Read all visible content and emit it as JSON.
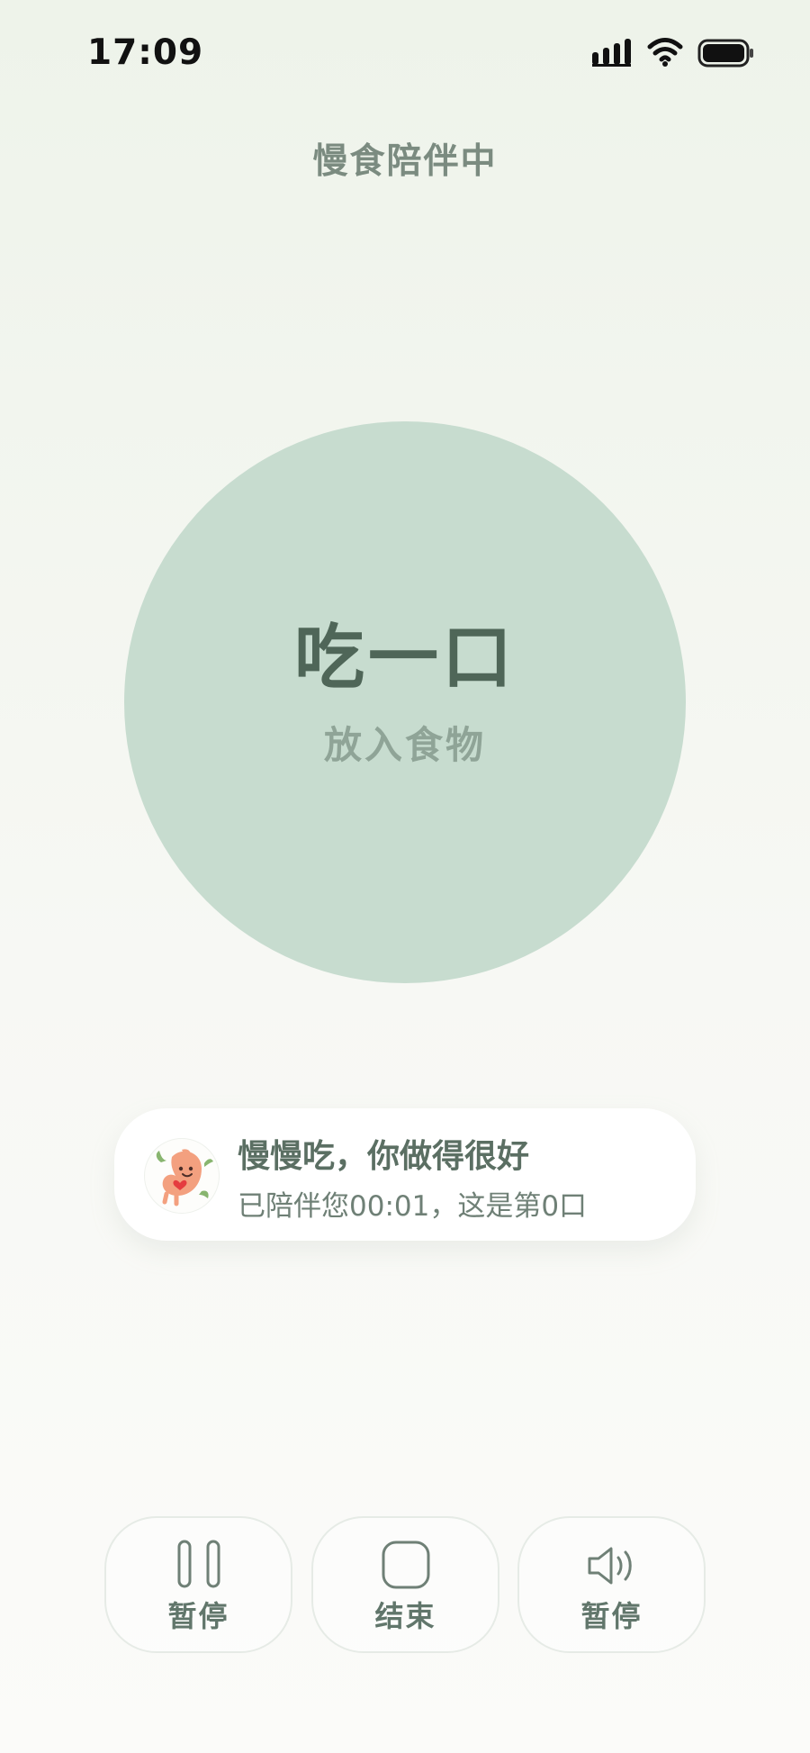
{
  "status_bar": {
    "time": "17:09",
    "icons": [
      "cellular-signal-icon",
      "wifi-icon",
      "battery-icon"
    ]
  },
  "header": {
    "title": "慢食陪伴中"
  },
  "bite_button": {
    "label": "吃一口",
    "subtitle": "放入食物",
    "color": "#c7dccf"
  },
  "message": {
    "avatar": "stomach-mascot-icon",
    "title": "慢慢吃，你做得很好",
    "subtitle": "已陪伴您00:01，这是第0口"
  },
  "controls": [
    {
      "icon": "pause-icon",
      "label": "暂停"
    },
    {
      "icon": "stop-icon",
      "label": "结束"
    },
    {
      "icon": "speaker-icon",
      "label": "暂停"
    }
  ],
  "colors": {
    "background_top": "#eef3ea",
    "background_bottom": "#fbfbf9",
    "accent_green": "#61766b"
  }
}
